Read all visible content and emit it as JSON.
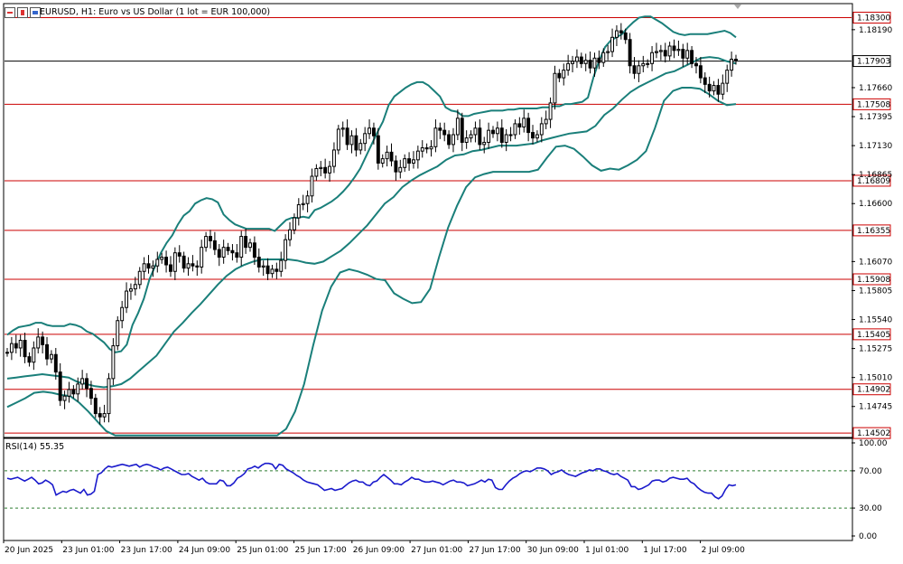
{
  "header": {
    "title": "EURUSD, H1:  Euro vs US Dollar (1 lot = EUR 100,000)"
  },
  "colors": {
    "candle": "#000000",
    "bollinger": "#1a7f7a",
    "hline": "#cc0000",
    "current_line": "#000000",
    "rsi": "#1a1acc",
    "rsi_levels": "#2e7d32",
    "price_tag_bg": "#ffffff"
  },
  "chart_data": [
    {
      "type": "candlestick",
      "symbol": "EURUSD",
      "timeframe": "H1",
      "ylim": [
        1.1447,
        1.1842
      ],
      "price_ticks": [
        "1.18190",
        "1.17660",
        "1.17395",
        "1.17130",
        "1.16865",
        "1.16600",
        "1.16070",
        "1.15805",
        "1.15540",
        "1.15275",
        "1.15010",
        "1.14745"
      ],
      "x_labels": [
        "20 Jun 2025",
        "23 Jun 01:00",
        "23 Jun 17:00",
        "24 Jun 09:00",
        "25 Jun 01:00",
        "25 Jun 17:00",
        "26 Jun 09:00",
        "27 Jun 01:00",
        "27 Jun 17:00",
        "30 Jun 09:00",
        "1 Jul 01:00",
        "1 Jul 17:00",
        "2 Jul 09:00"
      ],
      "horizontal_lines": [
        "1.18300",
        "1.17508",
        "1.16809",
        "1.16355",
        "1.15908",
        "1.15405",
        "1.14902",
        "1.14502"
      ],
      "current_price": "1.17903",
      "close_series": [
        1.1524,
        1.1532,
        1.1528,
        1.1535,
        1.152,
        1.1515,
        1.1528,
        1.1538,
        1.1531,
        1.1518,
        1.1522,
        1.1506,
        1.148,
        1.1484,
        1.149,
        1.1486,
        1.1495,
        1.15,
        1.1491,
        1.1482,
        1.1468,
        1.1465,
        1.1468,
        1.15,
        1.153,
        1.1553,
        1.1565,
        1.158,
        1.1582,
        1.1586,
        1.1598,
        1.1605,
        1.1601,
        1.1603,
        1.1609,
        1.1611,
        1.1604,
        1.1598,
        1.1615,
        1.1612,
        1.1601,
        1.1605,
        1.1603,
        1.1602,
        1.162,
        1.163,
        1.1626,
        1.1618,
        1.1611,
        1.162,
        1.1617,
        1.1615,
        1.1611,
        1.163,
        1.162,
        1.1624,
        1.1611,
        1.1602,
        1.1603,
        1.1596,
        1.16,
        1.1598,
        1.1608,
        1.1627,
        1.1636,
        1.1647,
        1.1659,
        1.166,
        1.1667,
        1.1685,
        1.1692,
        1.1693,
        1.1688,
        1.1694,
        1.1709,
        1.1728,
        1.1729,
        1.1714,
        1.1722,
        1.1709,
        1.1715,
        1.1724,
        1.1729,
        1.1722,
        1.1697,
        1.1701,
        1.1707,
        1.1699,
        1.1689,
        1.1693,
        1.1701,
        1.1697,
        1.17,
        1.1708,
        1.1711,
        1.171,
        1.1712,
        1.1729,
        1.1727,
        1.1723,
        1.1714,
        1.1723,
        1.1738,
        1.1716,
        1.172,
        1.1723,
        1.1729,
        1.1714,
        1.1716,
        1.1727,
        1.1724,
        1.1729,
        1.1716,
        1.1723,
        1.1723,
        1.1733,
        1.173,
        1.1738,
        1.1725,
        1.172,
        1.1723,
        1.1733,
        1.1737,
        1.1752,
        1.1779,
        1.1775,
        1.1782,
        1.1788,
        1.179,
        1.1794,
        1.1788,
        1.1791,
        1.1784,
        1.1793,
        1.1789,
        1.1798,
        1.1799,
        1.1812,
        1.1818,
        1.1816,
        1.181,
        1.1786,
        1.1779,
        1.1786,
        1.1788,
        1.1788,
        1.1798,
        1.1799,
        1.18,
        1.1795,
        1.1804,
        1.18,
        1.1801,
        1.1793,
        1.18,
        1.1788,
        1.1786,
        1.1775,
        1.1769,
        1.1763,
        1.1768,
        1.176,
        1.177,
        1.1782,
        1.1792,
        1.1791
      ],
      "bb_upper": [
        1.154,
        1.1544,
        1.1547,
        1.1548,
        1.1549,
        1.1551,
        1.1551,
        1.1549,
        1.1548,
        1.1548,
        1.1548,
        1.155,
        1.1549,
        1.1547,
        1.1543,
        1.1541,
        1.1537,
        1.1533,
        1.1527,
        1.1524,
        1.1525,
        1.1531,
        1.1549,
        1.156,
        1.1573,
        1.1591,
        1.1603,
        1.1615,
        1.1624,
        1.1631,
        1.1641,
        1.1649,
        1.1653,
        1.166,
        1.1663,
        1.1665,
        1.1664,
        1.1661,
        1.165,
        1.1645,
        1.1641,
        1.1639,
        1.1637,
        1.1637,
        1.1637,
        1.1637,
        1.1637,
        1.1635,
        1.164,
        1.1645,
        1.1647,
        1.1647,
        1.1648,
        1.1647,
        1.1654,
        1.1656,
        1.1659,
        1.1662,
        1.1666,
        1.1671,
        1.1677,
        1.1684,
        1.1692,
        1.1703,
        1.1714,
        1.1725,
        1.1735,
        1.175,
        1.1758,
        1.1762,
        1.1766,
        1.1769,
        1.1771,
        1.1771,
        1.1768,
        1.1763,
        1.1758,
        1.1748,
        1.1745,
        1.1744,
        1.174,
        1.174,
        1.1742,
        1.1743,
        1.1744,
        1.1745,
        1.1745,
        1.1745,
        1.1746,
        1.1746,
        1.1747,
        1.1747,
        1.1747,
        1.1747,
        1.1748,
        1.1748,
        1.1749,
        1.1749,
        1.1751,
        1.1751,
        1.1752,
        1.1753,
        1.1757,
        1.1776,
        1.1791,
        1.1803,
        1.1809,
        1.1812,
        1.1815,
        1.1821,
        1.1826,
        1.183,
        1.1831,
        1.1831,
        1.1828,
        1.1825,
        1.1821,
        1.1817,
        1.1815,
        1.1814,
        1.1815,
        1.1815,
        1.1815,
        1.1815,
        1.1816,
        1.1817,
        1.1818,
        1.1816,
        1.1812
      ],
      "bb_middle": [
        1.15,
        1.1501,
        1.1502,
        1.1503,
        1.1504,
        1.1503,
        1.1502,
        1.1501,
        1.1497,
        1.1495,
        1.1493,
        1.1492,
        1.1493,
        1.1495,
        1.15,
        1.1507,
        1.1514,
        1.1521,
        1.1532,
        1.1543,
        1.1551,
        1.156,
        1.1568,
        1.1577,
        1.1586,
        1.1594,
        1.16,
        1.1604,
        1.1607,
        1.1609,
        1.1609,
        1.1609,
        1.1609,
        1.1608,
        1.1606,
        1.1605,
        1.1607,
        1.1612,
        1.1617,
        1.1624,
        1.1632,
        1.164,
        1.165,
        1.166,
        1.1666,
        1.1675,
        1.1681,
        1.1686,
        1.169,
        1.1694,
        1.17,
        1.1704,
        1.1705,
        1.1708,
        1.1709,
        1.1711,
        1.1713,
        1.1713,
        1.1713,
        1.1714,
        1.1715,
        1.1718,
        1.172,
        1.1722,
        1.1724,
        1.1725,
        1.1726,
        1.1731,
        1.1741,
        1.1747,
        1.1755,
        1.1762,
        1.1767,
        1.1771,
        1.1775,
        1.1779,
        1.1781,
        1.1785,
        1.1789,
        1.1793,
        1.1794,
        1.1793,
        1.179,
        1.1788
      ],
      "bb_lower": [
        1.1474,
        1.1478,
        1.1482,
        1.1487,
        1.1488,
        1.1487,
        1.1485,
        1.1484,
        1.1478,
        1.147,
        1.1461,
        1.1452,
        1.1448,
        1.1448,
        1.1448,
        1.1448,
        1.1448,
        1.1448,
        1.1448,
        1.1448,
        1.1448,
        1.1448,
        1.1448,
        1.1448,
        1.1448,
        1.1448,
        1.1448,
        1.1448,
        1.1448,
        1.1448,
        1.1448,
        1.1454,
        1.147,
        1.1495,
        1.153,
        1.1562,
        1.1584,
        1.1597,
        1.16,
        1.1598,
        1.1595,
        1.1591,
        1.159,
        1.1578,
        1.1573,
        1.1569,
        1.157,
        1.1582,
        1.1611,
        1.1638,
        1.1658,
        1.1675,
        1.1684,
        1.1687,
        1.1689,
        1.1689,
        1.1689,
        1.1689,
        1.1689,
        1.1691,
        1.1702,
        1.1712,
        1.1713,
        1.171,
        1.1703,
        1.1695,
        1.169,
        1.1692,
        1.1691,
        1.1695,
        1.17,
        1.1708,
        1.1729,
        1.1754,
        1.1763,
        1.1766,
        1.1766,
        1.1765,
        1.176,
        1.1754,
        1.175,
        1.1751
      ]
    },
    {
      "type": "line",
      "title": "RSI(14) 55.35",
      "ylim": [
        0,
        100
      ],
      "y_ticks": [
        "100.00",
        "70.00",
        "30.00",
        "0.00"
      ],
      "levels": [
        70,
        30
      ],
      "values": [
        62,
        61,
        62,
        63,
        61,
        59,
        61,
        63,
        60,
        56,
        57,
        60,
        58,
        55,
        44,
        46,
        48,
        47,
        49,
        50,
        48,
        46,
        50,
        44,
        45,
        48,
        66,
        68,
        72,
        75,
        74,
        75,
        76,
        77,
        76,
        75,
        76,
        77,
        74,
        76,
        77,
        76,
        74,
        73,
        71,
        73,
        74,
        72,
        70,
        68,
        66,
        66,
        67,
        64,
        62,
        60,
        62,
        58,
        56,
        56,
        56,
        60,
        59,
        54,
        54,
        57,
        62,
        64,
        67,
        72,
        73,
        75,
        73,
        76,
        78,
        78,
        77,
        72,
        77,
        76,
        72,
        70,
        68,
        65,
        63,
        60,
        58,
        57,
        56,
        55,
        52,
        49,
        50,
        51,
        49,
        50,
        51,
        54,
        57,
        59,
        60,
        58,
        58,
        55,
        54,
        58,
        59,
        63,
        66,
        63,
        60,
        56,
        56,
        55,
        58,
        60,
        63,
        61,
        61,
        59,
        58,
        58,
        59,
        58,
        57,
        55,
        57,
        59,
        60,
        58,
        58,
        57,
        54,
        55,
        56,
        58,
        60,
        58,
        61,
        60,
        52,
        50,
        50,
        55,
        59,
        62,
        64,
        67,
        69,
        70,
        69,
        71,
        73,
        73,
        72,
        70,
        66,
        68,
        69,
        71,
        68,
        66,
        65,
        64,
        66,
        68,
        69,
        71,
        70,
        72,
        72,
        70,
        69,
        67,
        66,
        67,
        64,
        62,
        60,
        53,
        53,
        50,
        51,
        53,
        55,
        59,
        60,
        60,
        58,
        59,
        62,
        63,
        62,
        61,
        61,
        62,
        58,
        56,
        52,
        49,
        47,
        46,
        46,
        42,
        40,
        43,
        50,
        55,
        54,
        55
      ]
    }
  ]
}
